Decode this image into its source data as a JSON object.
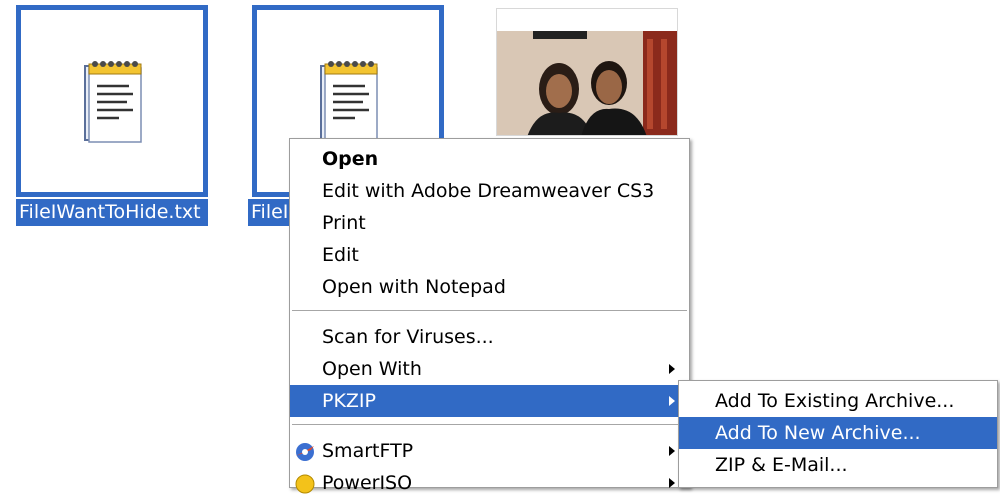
{
  "files": [
    {
      "name": "FileIWantToHide.txt",
      "icon": "notepad-text-file-icon"
    },
    {
      "name": "FileIWantToHide.txt",
      "icon": "notepad-text-file-icon"
    }
  ],
  "photo": {
    "icon": "photo-thumbnail"
  },
  "context_menu": {
    "items": [
      {
        "label": "Open"
      },
      {
        "label": "Edit with Adobe Dreamweaver CS3"
      },
      {
        "label": "Print"
      },
      {
        "label": "Edit"
      },
      {
        "label": "Open with Notepad"
      },
      {
        "label": "Scan for Viruses..."
      },
      {
        "label": "Open With"
      },
      {
        "label": "PKZIP"
      },
      {
        "label": "SmartFTP",
        "icon": "smartftp-icon"
      },
      {
        "label": "PowerISO",
        "icon": "poweriso-icon"
      }
    ]
  },
  "submenu": {
    "items": [
      {
        "label": "Add To Existing Archive..."
      },
      {
        "label": "Add To New Archive..."
      },
      {
        "label": "ZIP & E-Mail..."
      }
    ]
  },
  "colors": {
    "selection": "#316ac5",
    "menu_bg": "#ffffff"
  }
}
